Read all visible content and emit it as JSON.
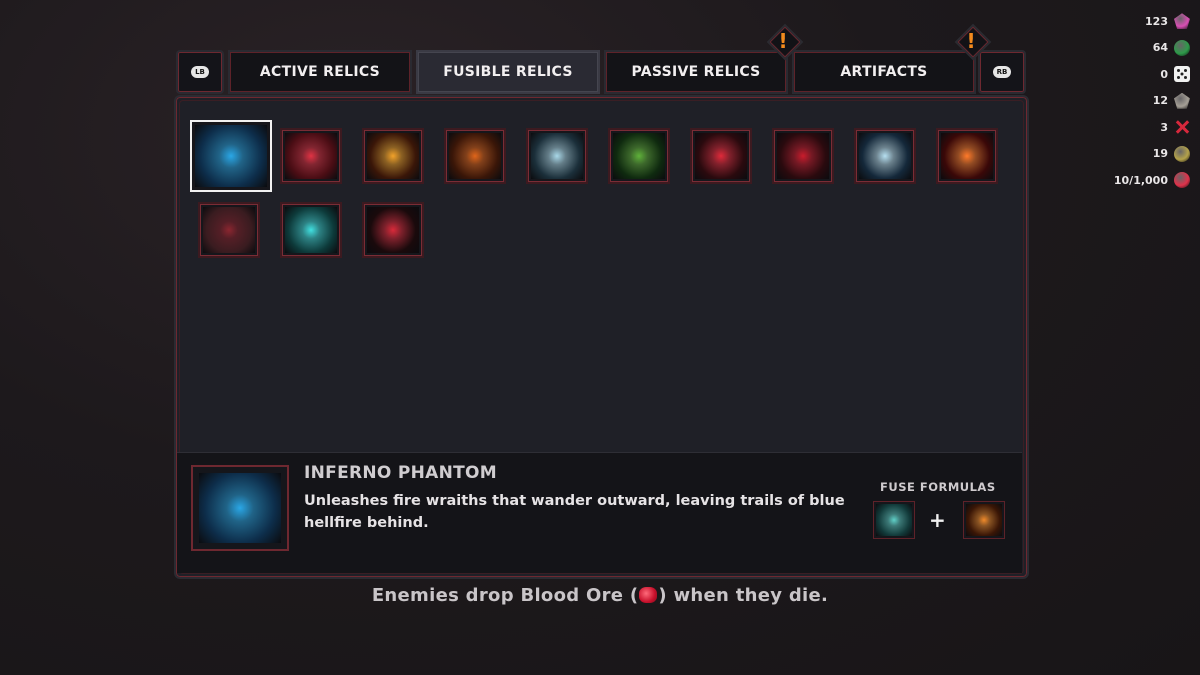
{
  "resources": [
    {
      "value": "123",
      "icon": "pink-crystal-icon",
      "color": "#d94fb4"
    },
    {
      "value": "64",
      "icon": "green-orb-icon",
      "color": "#2e9a4a"
    },
    {
      "value": "0",
      "icon": "die-icon",
      "color": "#f1f1f1"
    },
    {
      "value": "12",
      "icon": "gray-rock-icon",
      "color": "#a59f96"
    },
    {
      "value": "3",
      "icon": "red-cross-icon",
      "color": "#d7283c"
    },
    {
      "value": "19",
      "icon": "gold-ore-icon",
      "color": "#b4a24a"
    },
    {
      "value": "10/1,000",
      "icon": "blood-ore-icon",
      "color": "#e0324b"
    }
  ],
  "tabs": {
    "lb": "LB",
    "rb": "RB",
    "items": [
      {
        "label": "ACTIVE RELICS"
      },
      {
        "label": "FUSIBLE RELICS"
      },
      {
        "label": "PASSIVE RELICS"
      },
      {
        "label": "ARTIFACTS"
      }
    ],
    "active_index": 1,
    "alert_mark": "!"
  },
  "relics": [
    {
      "name": "inferno-phantom",
      "colors": [
        "#0d2d4a",
        "#2aa7e6"
      ]
    },
    {
      "name": "black-hole",
      "colors": [
        "#4a0d14",
        "#e03344"
      ]
    },
    {
      "name": "fire-lightning",
      "colors": [
        "#3a1608",
        "#f2a22a"
      ]
    },
    {
      "name": "meteor-shower",
      "colors": [
        "#3a1608",
        "#e0651a"
      ]
    },
    {
      "name": "frost-spider",
      "colors": [
        "#1b2f3a",
        "#a9d8e8"
      ]
    },
    {
      "name": "poison-cloud",
      "colors": [
        "#0f2a0f",
        "#5fb13a"
      ]
    },
    {
      "name": "blood-spikes",
      "colors": [
        "#2a0a0e",
        "#e02a3a"
      ]
    },
    {
      "name": "blood-cloak",
      "colors": [
        "#2a0a0e",
        "#c91c2c"
      ]
    },
    {
      "name": "ice-shards",
      "colors": [
        "#14283a",
        "#b6dff0"
      ]
    },
    {
      "name": "fire-breath",
      "colors": [
        "#3a0808",
        "#ff7a2a"
      ]
    },
    {
      "name": "blood-eye",
      "colors": [
        "#3a1c20",
        "#8b2630"
      ]
    },
    {
      "name": "lightning-strike",
      "colors": [
        "#0d3a3a",
        "#41e0e0"
      ]
    },
    {
      "name": "blood-ring",
      "colors": [
        "#1a0a0c",
        "#d92a3a"
      ]
    }
  ],
  "selected": {
    "title": "INFERNO PHANTOM",
    "description": "Unleashes fire wraiths that wander outward, leaving trails of blue hellfire behind.",
    "fuse_label": "FUSE FORMULAS",
    "fuse_plus": "+",
    "fuse_a": {
      "name": "spectral-ghost",
      "colors": [
        "#123a3a",
        "#5fd0c8"
      ]
    },
    "fuse_b": {
      "name": "fire-burst",
      "colors": [
        "#3a1606",
        "#f08a2a"
      ]
    }
  },
  "footer": {
    "before": "Enemies drop Blood Ore (",
    "after": ") when they die."
  }
}
